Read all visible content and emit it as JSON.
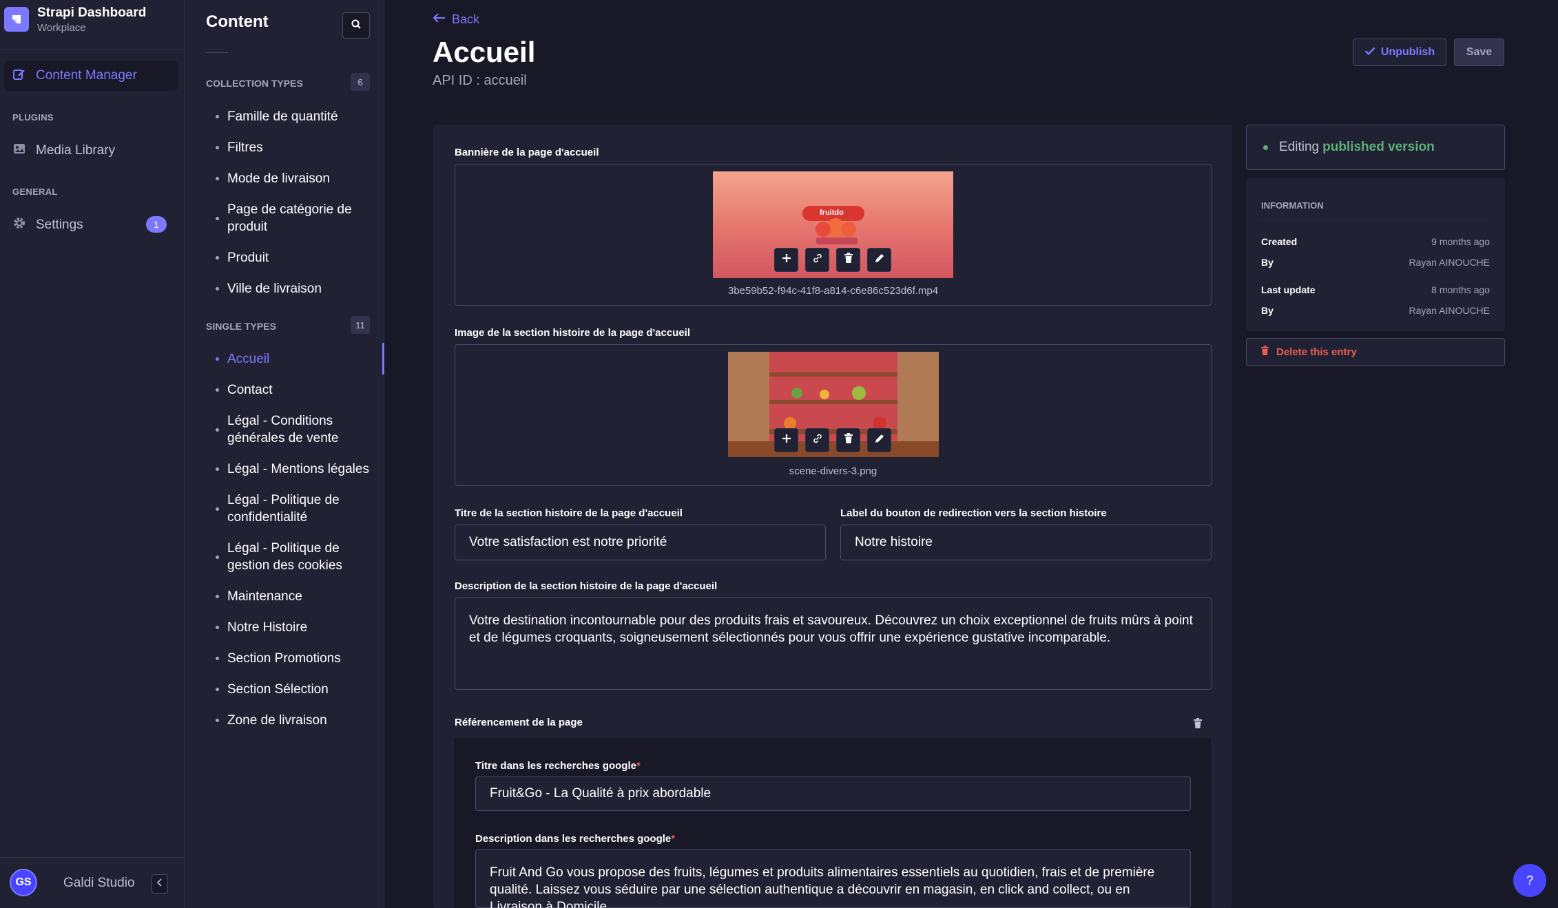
{
  "brand": {
    "title": "Strapi Dashboard",
    "subtitle": "Workplace"
  },
  "mainnav": {
    "active_label": "Content Manager",
    "plugins_heading": "PLUGINS",
    "media_label": "Media Library",
    "general_heading": "GENERAL",
    "settings_label": "Settings",
    "settings_badge": "1"
  },
  "user": {
    "initials": "GS",
    "name": "Galdi Studio"
  },
  "subnav": {
    "title": "Content",
    "collection_heading": "COLLECTION TYPES",
    "collection_count": "6",
    "collection_items": [
      "Famille de quantité",
      "Filtres",
      "Mode de livraison",
      "Page de catégorie de produit",
      "Produit",
      "Ville de livraison"
    ],
    "single_heading": "SINGLE TYPES",
    "single_count": "11",
    "single_items": [
      "Accueil",
      "Contact",
      "Légal - Conditions générales de vente",
      "Légal - Mentions légales",
      "Légal - Politique de confidentialité",
      "Légal - Politique de gestion des cookies",
      "Maintenance",
      "Notre Histoire",
      "Section Promotions",
      "Section Sélection",
      "Zone de livraison"
    ]
  },
  "header": {
    "back_label": "Back",
    "title": "Accueil",
    "api_id": "API ID : accueil",
    "unpublish_label": "Unpublish",
    "save_label": "Save"
  },
  "form": {
    "banner_label": "Bannière de la page d'accueil",
    "banner_file": "3be59b52-f94c-41f8-a814-c6e86c523d6f.mp4",
    "banner_thumb_text": "fruitdo",
    "story_image_label": "Image de la section histoire de la page d'accueil",
    "story_image_file": "scene-divers-3.png",
    "story_title_label": "Titre de la section histoire de la page d'accueil",
    "story_title_value": "Votre satisfaction est notre priorité",
    "story_button_label": "Label du bouton de redirection vers la section histoire",
    "story_button_value": "Notre histoire",
    "story_desc_label": "Description de la section histoire de la page d'accueil",
    "story_desc_value": "Votre destination incontournable pour des produits frais et savoureux. Découvrez un choix exceptionnel de fruits mûrs à point et de légumes croquants, soigneusement sélectionnés pour vous offrir une expérience gustative incomparable.",
    "seo_label": "Référencement de la page",
    "seo_title_label": "Titre dans les recherches google",
    "seo_title_value": "Fruit&Go - La Qualité à prix abordable",
    "seo_desc_label": "Description dans les recherches google",
    "seo_desc_value": "Fruit And Go vous propose des fruits, légumes et produits alimentaires essentiels au quotidien, frais et de première qualité. Laissez vous séduire par une sélection authentique a découvrir en magasin, en click and collect, ou en Livraison à Domicile.",
    "required_mark": "*"
  },
  "side": {
    "status_prefix": "Editing",
    "status_strong": "published version",
    "info_heading": "INFORMATION",
    "created_label": "Created",
    "created_value": "9 months ago",
    "created_by_label": "By",
    "created_by_value": "Rayan AINOUCHE",
    "updated_label": "Last update",
    "updated_value": "8 months ago",
    "updated_by_label": "By",
    "updated_by_value": "Rayan AINOUCHE",
    "delete_label": "Delete this entry"
  },
  "help_label": "?",
  "colors": {
    "accent": "#7b79ff",
    "success": "#5cb176",
    "danger": "#ee5e52",
    "background": "#181826",
    "surface": "#212134"
  },
  "icons": [
    "strapi-logo-icon",
    "pencil-icon",
    "image-icon",
    "gear-icon",
    "search-icon",
    "arrow-left-icon",
    "check-icon",
    "plus-icon",
    "link-icon",
    "trash-icon",
    "chevron-left-icon"
  ]
}
